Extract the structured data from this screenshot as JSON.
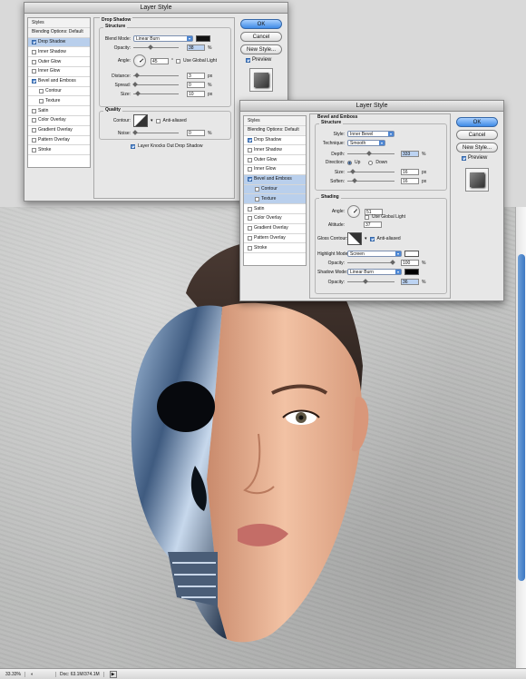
{
  "dialog1": {
    "title": "Layer Style",
    "styles": [
      {
        "label": "Styles",
        "type": "header"
      },
      {
        "label": "Blending Options: Default",
        "type": "header"
      },
      {
        "label": "Drop Shadow",
        "checked": true,
        "selected": true
      },
      {
        "label": "Inner Shadow",
        "checked": false
      },
      {
        "label": "Outer Glow",
        "checked": false
      },
      {
        "label": "Inner Glow",
        "checked": false
      },
      {
        "label": "Bevel and Emboss",
        "checked": true
      },
      {
        "label": "Contour",
        "checked": false,
        "sub": true
      },
      {
        "label": "Texture",
        "checked": false,
        "sub": true
      },
      {
        "label": "Satin",
        "checked": false
      },
      {
        "label": "Color Overlay",
        "checked": false
      },
      {
        "label": "Gradient Overlay",
        "checked": false
      },
      {
        "label": "Pattern Overlay",
        "checked": false
      },
      {
        "label": "Stroke",
        "checked": false
      }
    ],
    "section_title": "Drop Shadow",
    "structure_title": "Structure",
    "blend_mode_label": "Blend Mode:",
    "blend_mode": "Linear Burn",
    "shadow_color": "#111111",
    "opacity_label": "Opacity:",
    "opacity": "38",
    "opacity_unit": "%",
    "angle_label": "Angle:",
    "angle": "45",
    "angle_unit": "°",
    "global_light_label": "Use Global Light",
    "distance_label": "Distance:",
    "distance": "3",
    "spread_label": "Spread:",
    "spread": "0",
    "size_label": "Size:",
    "size": "10",
    "px": "px",
    "quality_title": "Quality",
    "contour_label": "Contour:",
    "antialias_label": "Anti-aliased",
    "noise_label": "Noise:",
    "noise": "0",
    "knockout_label": "Layer Knocks Out Drop Shadow",
    "ok": "OK",
    "cancel": "Cancel",
    "new_style": "New Style...",
    "preview": "Preview"
  },
  "dialog2": {
    "title": "Layer Style",
    "styles": [
      {
        "label": "Styles",
        "type": "header"
      },
      {
        "label": "Blending Options: Default",
        "type": "header"
      },
      {
        "label": "Drop Shadow",
        "checked": true
      },
      {
        "label": "Inner Shadow",
        "checked": false
      },
      {
        "label": "Outer Glow",
        "checked": false
      },
      {
        "label": "Inner Glow",
        "checked": false
      },
      {
        "label": "Bevel and Emboss",
        "checked": true,
        "selected": true
      },
      {
        "label": "Contour",
        "checked": false,
        "sub": true,
        "selected": true
      },
      {
        "label": "Texture",
        "checked": false,
        "sub": true,
        "selected": true
      },
      {
        "label": "Satin",
        "checked": false
      },
      {
        "label": "Color Overlay",
        "checked": false
      },
      {
        "label": "Gradient Overlay",
        "checked": false
      },
      {
        "label": "Pattern Overlay",
        "checked": false
      },
      {
        "label": "Stroke",
        "checked": false
      }
    ],
    "section_title": "Bevel and Emboss",
    "structure_title": "Structure",
    "style_label": "Style:",
    "style": "Inner Bevel",
    "technique_label": "Technique:",
    "technique": "Smooth",
    "depth_label": "Depth:",
    "depth": "333",
    "percent": "%",
    "direction_label": "Direction:",
    "dir_up": "Up",
    "dir_down": "Down",
    "size_label": "Size:",
    "size": "16",
    "soften_label": "Soften:",
    "soften": "16",
    "px": "px",
    "shading_title": "Shading",
    "angle_label": "Angle:",
    "angle": "51",
    "global_light_label": "Use Global Light",
    "altitude_label": "Altitude:",
    "altitude": "37",
    "gloss_label": "Gloss Contour:",
    "antialias_label": "Anti-aliased",
    "highlight_label": "Highlight Mode:",
    "highlight_mode": "Screen",
    "highlight_color": "#ffffff",
    "hl_opacity_label": "Opacity:",
    "hl_opacity": "100",
    "shadow_label": "Shadow Mode:",
    "shadow_mode": "Linear Burn",
    "shadow_color": "#000000",
    "sh_opacity_label": "Opacity:",
    "sh_opacity": "36",
    "ok": "OK",
    "cancel": "Cancel",
    "new_style": "New Style...",
    "preview": "Preview"
  },
  "status": {
    "zoom": "33.33%",
    "doc": "Doc: 63.1M/374.1M"
  },
  "colors": {
    "accent": "#3e8ae6",
    "selection": "#b9cfec"
  }
}
